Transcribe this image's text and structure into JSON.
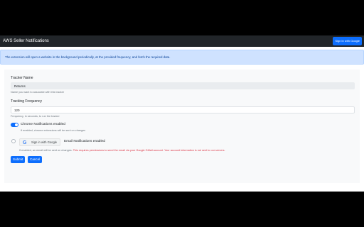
{
  "navbar": {
    "title": "AWS Seller Notifications",
    "signin_label": "Sign In with Google"
  },
  "alert": {
    "text": "The extension will open a website in the background periodically, at the provided frequency, and fetch the required data."
  },
  "form": {
    "tracker_name": {
      "label": "Tracker Name",
      "value": "Returns",
      "help": "Name you want to associate with this tracker"
    },
    "tracking_frequency": {
      "label": "Tracking Frequency",
      "value": "120",
      "help": "Frequency, in seconds, to run the tracker"
    },
    "chrome_notifications": {
      "label": "Chrome Notifications enabled",
      "enabled": true,
      "help": "If enabled, chrome extensions will be sent on changes"
    },
    "email_notifications": {
      "signin_label": "Sign in with Google",
      "label": "Email Notifications enabled",
      "help": "If enabled, an email will be sent on changes.",
      "warning": "This requires permissions to send the email via your Google GMail account. Your account information is not sent to our servers."
    },
    "submit_label": "Submit",
    "cancel_label": "Cancel"
  },
  "colors": {
    "primary": "#0d6efd",
    "navbar": "#212529",
    "alert_bg": "#cfe2ff",
    "warning": "#dc3545"
  }
}
